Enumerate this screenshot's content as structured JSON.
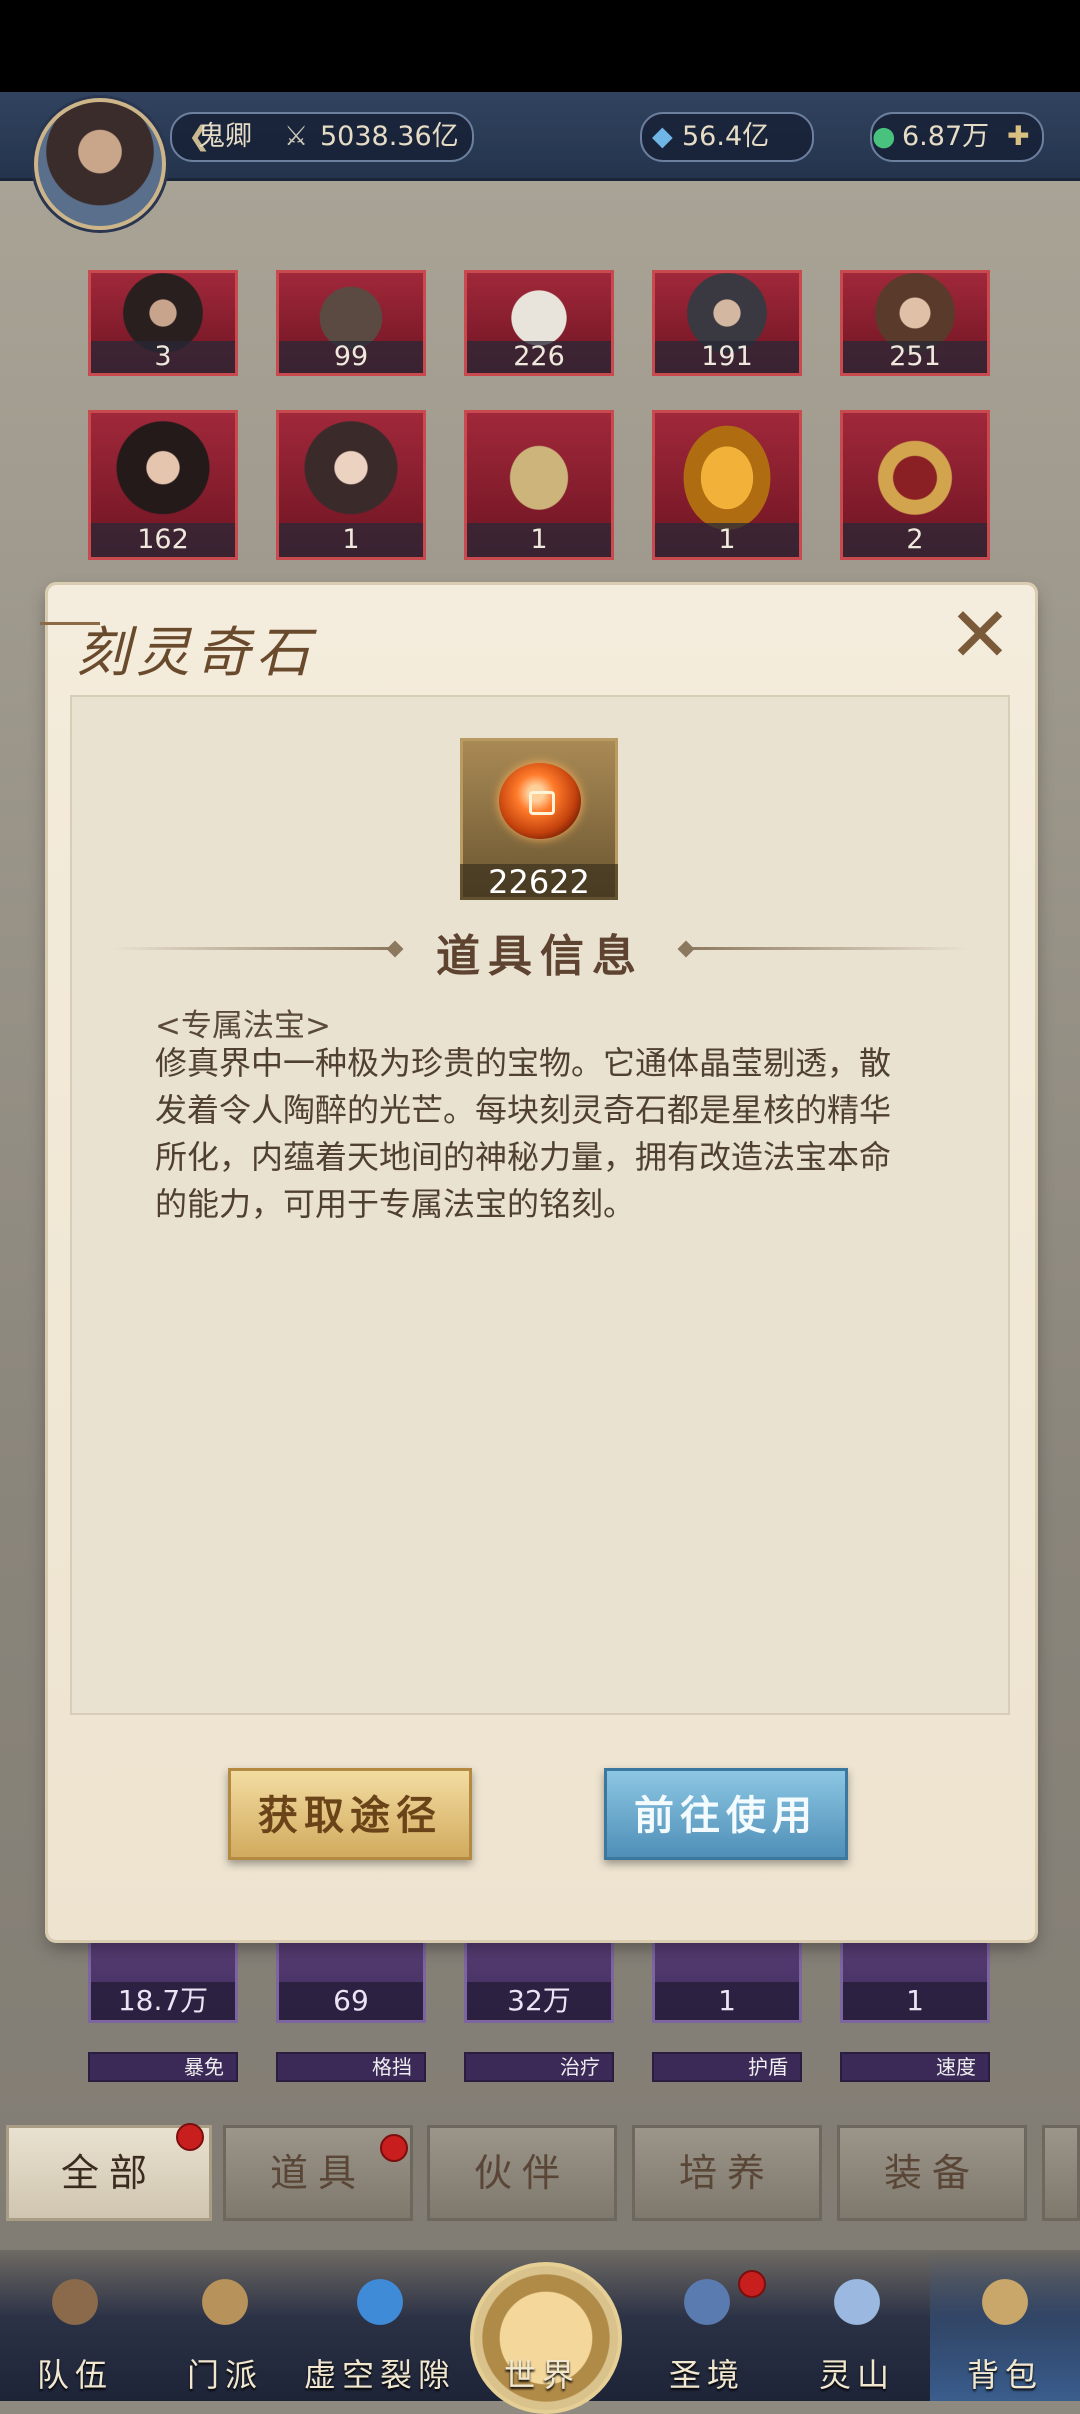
{
  "header": {
    "player_name": "鬼卿",
    "power": "5038.36亿",
    "crystal": "56.4亿",
    "jade": "6.87万"
  },
  "grid": {
    "row1": [
      "3",
      "99",
      "226",
      "191",
      "251"
    ],
    "row2": [
      "162",
      "1",
      "1",
      "1",
      "2"
    ],
    "row3": [
      "18.7万",
      "69",
      "32万",
      "1",
      "1"
    ],
    "stats": [
      "暴免",
      "格挡",
      "治疗",
      "护盾",
      "速度"
    ]
  },
  "dialog": {
    "title": "刻灵奇石",
    "close_symbol": "✕",
    "item_count": "22622",
    "info_title": "道具信息",
    "category": "<专属法宝>",
    "description": "修真界中一种极为珍贵的宝物。它通体晶莹剔透，散发着令人陶醉的光芒。每块刻灵奇石都是星核的精华所化，内蕴着天地间的神秘力量，拥有改造法宝本命的能力，可用于专属法宝的铭刻。",
    "btn_obtain": "获取途径",
    "btn_use": "前往使用"
  },
  "tabs": [
    "全部",
    "道具",
    "伙伴",
    "培养",
    "装备"
  ],
  "nav": [
    "队伍",
    "门派",
    "虚空裂隙",
    "世界",
    "圣境",
    "灵山",
    "背包"
  ],
  "colors": {
    "card_red": "#a0283a",
    "card_purple": "#5b3f78",
    "btn_gold": "#d1ab5e",
    "btn_blue": "#4f8fb8",
    "badge_red": "#c81e1e"
  }
}
